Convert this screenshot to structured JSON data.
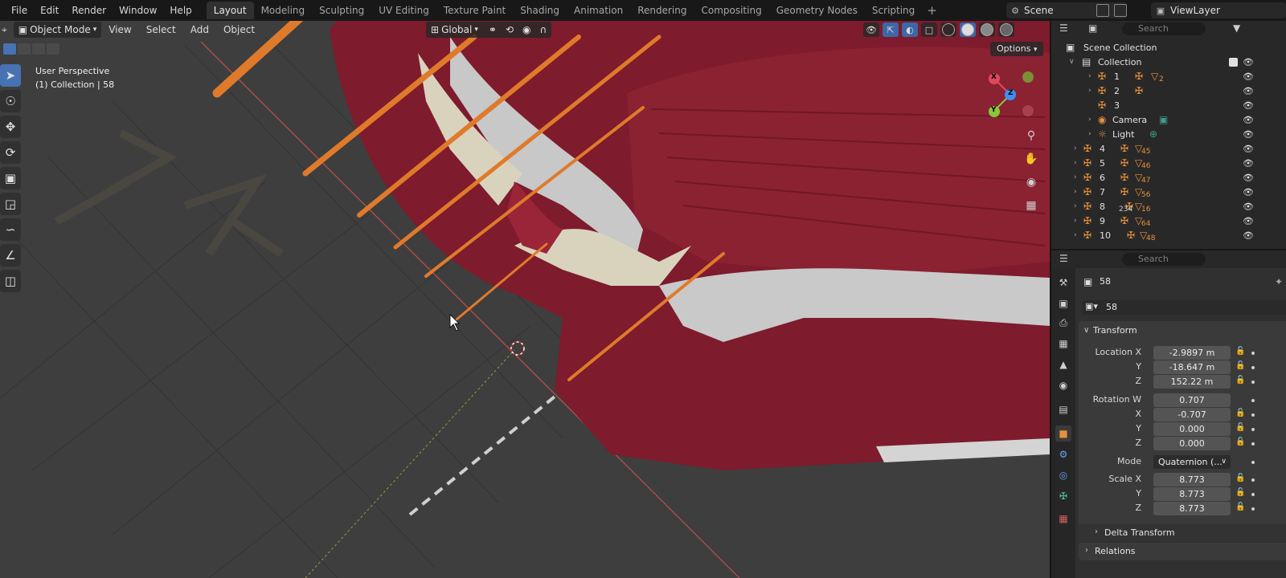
{
  "menu": [
    "File",
    "Edit",
    "Render",
    "Window",
    "Help"
  ],
  "workspaces": [
    "Layout",
    "Modeling",
    "Sculpting",
    "UV Editing",
    "Texture Paint",
    "Shading",
    "Animation",
    "Rendering",
    "Compositing",
    "Geometry Nodes",
    "Scripting"
  ],
  "active_workspace": "Layout",
  "scene": "Scene",
  "view_layer": "ViewLayer",
  "viewport": {
    "mode": "Object Mode",
    "menus": [
      "View",
      "Select",
      "Add",
      "Object"
    ],
    "transform_orientation": "Global",
    "info_line1": "User Perspective",
    "info_line2": "(1) Collection | 58",
    "options_label": "Options",
    "gizmo": {
      "x": "X",
      "y": "Y",
      "z": "Z"
    }
  },
  "outliner": {
    "search_placeholder": "Search",
    "scene_collection": "Scene Collection",
    "collection": "Collection",
    "rows": [
      {
        "label": "1",
        "sub": "2"
      },
      {
        "label": "2",
        "sub": ""
      },
      {
        "label": "3",
        "sub": ""
      },
      {
        "label": "Camera",
        "sub": ""
      },
      {
        "label": "Light",
        "sub": ""
      },
      {
        "label": "4",
        "sub": "45"
      },
      {
        "label": "5",
        "sub": "46"
      },
      {
        "label": "6",
        "sub": "47"
      },
      {
        "label": "7",
        "sub": "56"
      },
      {
        "label": "8",
        "sub": "16",
        "sub2": "234"
      },
      {
        "label": "9",
        "sub": "64"
      },
      {
        "label": "10",
        "sub": "48"
      }
    ]
  },
  "properties": {
    "search_placeholder": "Search",
    "object_name": "58",
    "object_field": "58",
    "transform": {
      "title": "Transform",
      "location_x_label": "Location X",
      "location_x": "-2.9897 m",
      "location_y_label": "Y",
      "location_y": "-18.647 m",
      "location_z_label": "Z",
      "location_z": "152.22 m",
      "rotation_w_label": "Rotation W",
      "rotation_w": "0.707",
      "rotation_x_label": "X",
      "rotation_x": "-0.707",
      "rotation_y_label": "Y",
      "rotation_y": "0.000",
      "rotation_z_label": "Z",
      "rotation_z": "0.000",
      "mode_label": "Mode",
      "mode_value": "Quaternion (...",
      "scale_x_label": "Scale X",
      "scale_x": "8.773",
      "scale_y_label": "Y",
      "scale_y": "8.773",
      "scale_z_label": "Z",
      "scale_z": "8.773"
    },
    "delta_transform": "Delta Transform",
    "relations": "Relations"
  },
  "colors": {
    "accent_blue": "#4772b3",
    "object_orange": "#e7913c",
    "muscle_red": "#7e1b2c",
    "bone": "#d9d3bd",
    "axis_x": "#e0485c",
    "axis_y": "#8ac63c",
    "axis_z": "#3f8df5"
  }
}
